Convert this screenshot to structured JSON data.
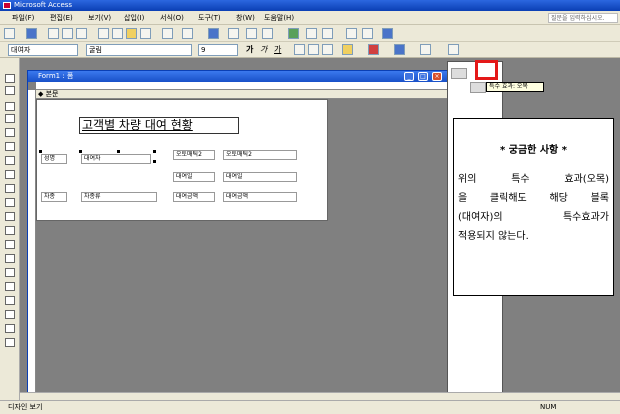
{
  "app": {
    "title": "Microsoft Access"
  },
  "menu": [
    "파일(F)",
    "편집(E)",
    "보기(V)",
    "삽입(I)",
    "서식(O)",
    "도구(T)",
    "창(W)",
    "도움말(H)"
  ],
  "help_search": {
    "placeholder": "질문을 입력하십시오."
  },
  "format_toolbar": {
    "object": "대여자",
    "font": "굴림",
    "size": "9",
    "bold": "가",
    "italic": "가",
    "underline": "가"
  },
  "form_window": {
    "title": "Form1 : 폼",
    "section": "본문"
  },
  "form": {
    "heading": "고객별 차량 대여 현황",
    "controls": [
      {
        "name": "label-name",
        "text": "성명"
      },
      {
        "name": "textbox-renter",
        "text": "대여자"
      },
      {
        "name": "label-auto1",
        "text": "오토매틱2"
      },
      {
        "name": "textbox-auto1",
        "text": "오토매틱2"
      },
      {
        "name": "label-rentday",
        "text": "대여일"
      },
      {
        "name": "textbox-rentday",
        "text": "대여일"
      },
      {
        "name": "label-cartype",
        "text": "차종"
      },
      {
        "name": "textbox-cartype",
        "text": "차종류"
      },
      {
        "name": "label-rentamount",
        "text": "대여금액"
      },
      {
        "name": "textbox-rentamount",
        "text": "대여금액"
      }
    ]
  },
  "tooltip": "특수 효과: 오목",
  "note": {
    "title": "* 궁금한 사항 *",
    "lines": [
      "위의 특수 효과(오목)",
      "을 클릭해도 해당 블록",
      "(대여자)의 특수효과가",
      "적용되지 않는다."
    ]
  },
  "statusbar": {
    "left": "디자인 보기",
    "right": "NUM"
  },
  "colors": {
    "titlebar": "#0a3fb4",
    "highlight": "#e41818",
    "workspace": "#808080"
  }
}
